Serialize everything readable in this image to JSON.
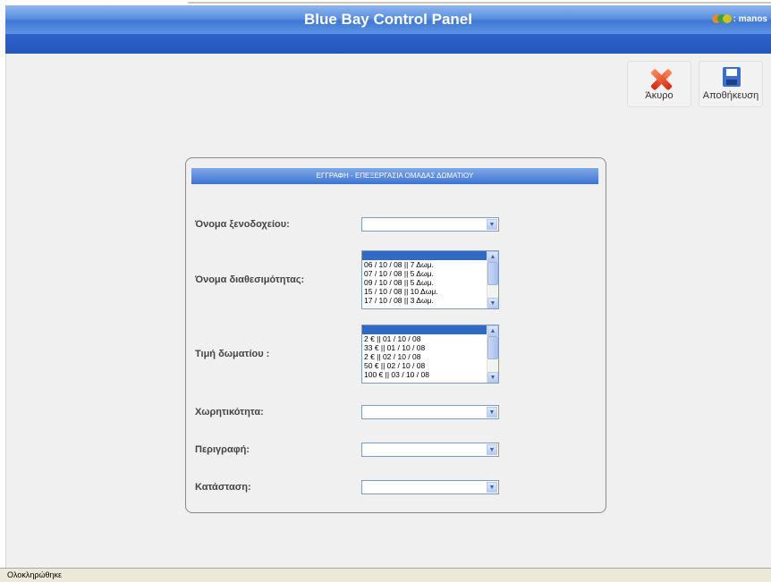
{
  "app": {
    "title": "Blue Bay Control Panel",
    "user": ": manos"
  },
  "toolbar": {
    "cancel_label": "Άκυρο",
    "save_label": "Αποθήκευση"
  },
  "form": {
    "heading": "ΕΓΓΡΑΦΗ - ΕΠΕΞΕΡΓΑΣΙΑ ΟΜΑΔΑΣ ΔΩΜΑΤΙΟΥ",
    "hotel_label": "Όνομα ξενοδοχείου:",
    "hotel_value": "",
    "availability_label": "Όνομα διαθεσιμότητας:",
    "availability_options": [
      "",
      "06 / 10 / 08 || 7 Δωμ.",
      "07 / 10 / 08 || 5 Δωμ.",
      "09 / 10 / 08 || 5 Δωμ.",
      "15 / 10 / 08 || 10 Δωμ.",
      "17 / 10 / 08 || 3 Δωμ."
    ],
    "price_label": "Τιμή δωματίου :",
    "price_options": [
      "",
      "2 € || 01 / 10 / 08",
      "33 € || 01 / 10 / 08",
      "2 € || 02 / 10 / 08",
      "50 € || 02 / 10 / 08",
      "100 € || 03 / 10 / 08"
    ],
    "capacity_label": "Χωρητικότητα:",
    "capacity_value": "",
    "description_label": "Περιγραφή:",
    "description_value": "",
    "status_label": "Κατάσταση:",
    "status_value": ""
  },
  "statusbar": {
    "text": "Ολοκληρώθηκε"
  },
  "icons": {
    "cancel": "close-icon",
    "save": "floppy-disk-icon",
    "user": "users-icon",
    "dropdown": "chevron-down-icon"
  },
  "colors": {
    "header_blue": "#3f78d4",
    "nav_blue": "#2456bc",
    "selection": "#316ac5"
  }
}
